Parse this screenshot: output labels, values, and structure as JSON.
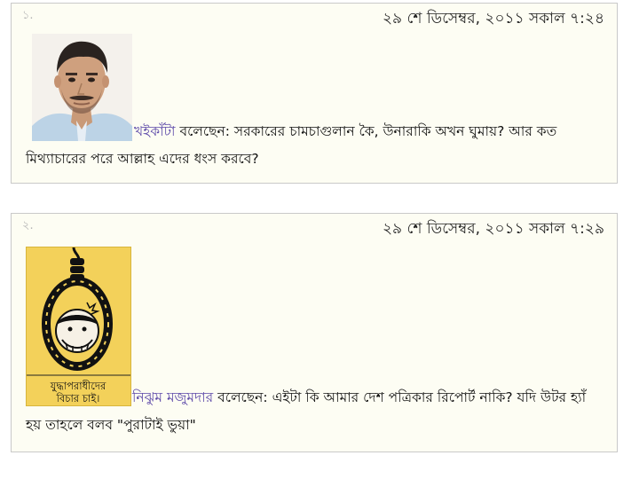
{
  "comments": [
    {
      "number": "১.",
      "timestamp": "২৯ শে ডিসেম্বর, ২০১১ সকাল ৭:২৪",
      "author": "খইকাঁটা",
      "verb": "বলেছেন:",
      "text": "সরকারের চামচাগুলান কৈ, উনারাকি অখন ঘুমায়? আর কত মিথ্যাচারের পরে আল্লাহ এদের ধংস করবে?"
    },
    {
      "number": "২.",
      "timestamp": "২৯ শে ডিসেম্বর, ২০১১ সকাল ৭:২৯",
      "author": "নিঝুম মজুমদার",
      "verb": "বলেছেন:",
      "text": "এইটা কি আমার দেশ পত্রিকার রিপোর্ট নাকি? যদি উটর হ্যাঁ হয় তাহলে বলব \"পুরাটাই ভুয়া\"",
      "avatar_caption_line1": "যুদ্ধাপরাধীদের",
      "avatar_caption_line2": "বিচার চাই।"
    }
  ]
}
